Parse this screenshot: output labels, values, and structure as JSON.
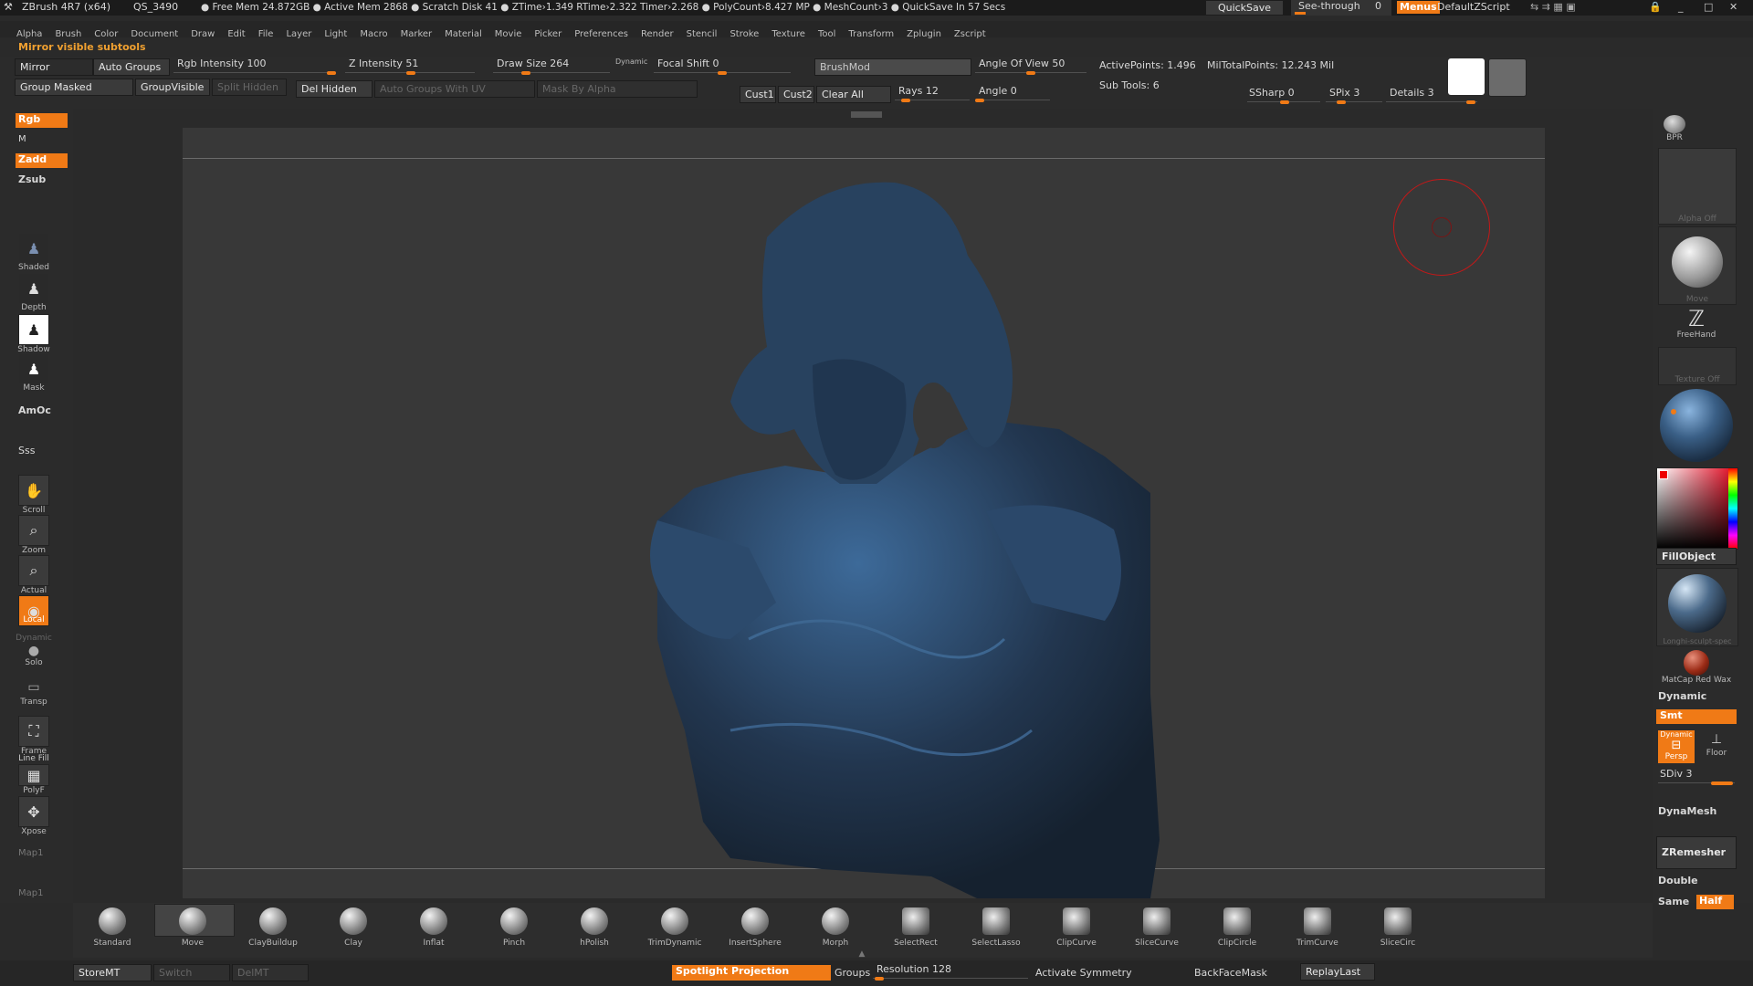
{
  "titlebar": {
    "app": "ZBrush 4R7 (x64)",
    "doc": "QS_3490",
    "stats": "● Free Mem 24.872GB ● Active Mem 2868 ● Scratch Disk 41 ● ZTime›1.349 RTime›2.322 Timer›2.268 ● PolyCount›8.427 MP ● MeshCount›3 ● QuickSave In 57 Secs",
    "quicksave": "QuickSave",
    "seethrough": "See-through",
    "seethrough_val": "0",
    "menus": "Menus",
    "script": "DefaultZScript"
  },
  "menubar": [
    "Alpha",
    "Brush",
    "Color",
    "Document",
    "Draw",
    "Edit",
    "File",
    "Layer",
    "Light",
    "Macro",
    "Marker",
    "Material",
    "Movie",
    "Picker",
    "Preferences",
    "Render",
    "Stencil",
    "Stroke",
    "Texture",
    "Tool",
    "Transform",
    "Zplugin",
    "Zscript"
  ],
  "tip": "Mirror visible subtools",
  "topshelf": {
    "mirror": "Mirror",
    "auto_groups": "Auto Groups",
    "group_masked": "Group Masked",
    "group_visible": "GroupVisible",
    "split_hidden": "Split Hidden",
    "del_hidden": "Del Hidden",
    "auto_groups_uv": "Auto Groups With UV",
    "mask_alpha": "Mask By Alpha",
    "rgb_intensity": "Rgb Intensity 100",
    "rgb_intensity_pct": 1.0,
    "z_intensity": "Z Intensity 51",
    "z_intensity_pct": 0.51,
    "draw_size": "Draw Size 264",
    "draw_size_pct": 0.26,
    "dynamic": "Dynamic",
    "focal_shift": "Focal Shift 0",
    "focal_shift_pct": 0.5,
    "brushmod": "BrushMod",
    "cust1": "Cust1",
    "cust2": "Cust2",
    "clear_all": "Clear All",
    "rays": "Rays 12",
    "rays_pct": 0.1,
    "angle_of_view": "Angle Of View 50",
    "angle_of_view_pct": 0.5,
    "angle": "Angle 0",
    "angle_pct": 0.0,
    "active_points": "ActivePoints: 1.496",
    "total_points": "MilTotalPoints: 12.243  Mil",
    "sub_tools": "Sub Tools: 6",
    "ssharp": "SSharp 0",
    "spix": "SPix 3",
    "details": "Details 3"
  },
  "leftshelf": {
    "rgb": "Rgb",
    "m": "M",
    "zadd": "Zadd",
    "zsub": "Zsub",
    "shaded": "Shaded",
    "depth": "Depth",
    "shadow": "Shadow",
    "mask": "Mask",
    "amoc": "AmOc",
    "sss": "Sss",
    "scroll": "Scroll",
    "zoom": "Zoom",
    "actual": "Actual",
    "local": "Local",
    "dynamic": "Dynamic",
    "solo": "Solo",
    "transp": "Transp",
    "frame": "Frame",
    "line_fill": "Line Fill",
    "polyf": "PolyF",
    "xpose": "Xpose",
    "map1": "Map1",
    "map1b": "Map1"
  },
  "rightshelf": {
    "bpr": "BPR",
    "alpha_off": "Alpha Off",
    "move": "Move",
    "freehand": "FreeHand",
    "texture_off": "Texture Off",
    "fill_object": "FillObject",
    "material_name": "Longhi-sculpt-spec",
    "matcap": "MatCap  Red  Wax",
    "dynamic": "Dynamic",
    "smt": "Smt",
    "dynamic2": "Dynamic",
    "persp": "Persp",
    "floor": "Floor",
    "sdiv": "SDiv 3",
    "dynamesh": "DynaMesh",
    "zremesher": "ZRemesher",
    "double": "Double",
    "same": "Same",
    "half": "Half"
  },
  "brushes": [
    "Standard",
    "Move",
    "ClayBuildup",
    "Clay",
    "Inflat",
    "Pinch",
    "hPolish",
    "TrimDynamic",
    "InsertSphere",
    "Morph",
    "SelectRect",
    "SelectLasso",
    "ClipCurve",
    "SliceCurve",
    "ClipCircle",
    "TrimCurve",
    "SliceCirc"
  ],
  "statusbar": {
    "storemt": "StoreMT",
    "switch": "Switch",
    "delmt": "DelMT",
    "spotlight": "Spotlight Projection",
    "groups": "Groups",
    "resolution": "Resolution 128",
    "activate_symmetry": "Activate Symmetry",
    "backfacemask": "BackFaceMask",
    "replaylast": "ReplayLast"
  },
  "colors": {
    "accent": "#f07a16",
    "mesh": "#2b4565"
  }
}
